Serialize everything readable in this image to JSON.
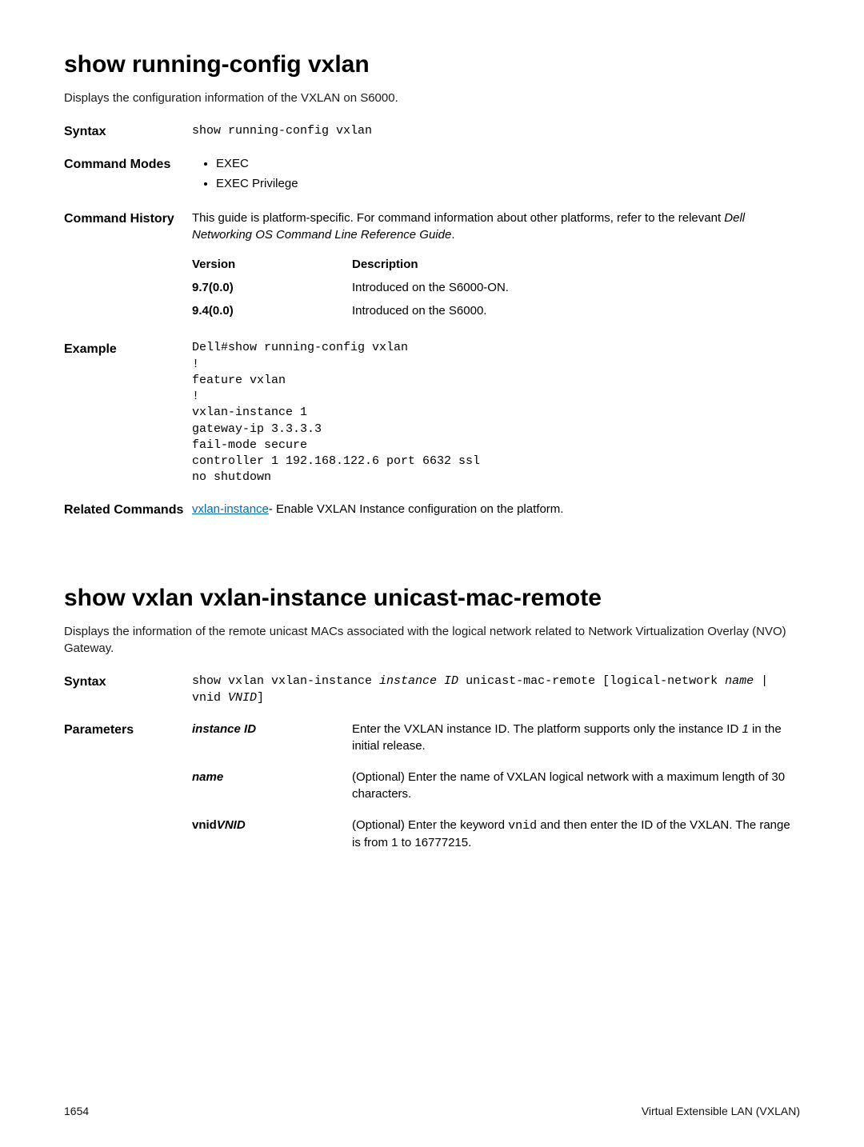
{
  "sections": [
    {
      "title": "show running-config vxlan",
      "desc": "Displays the configuration information of the VXLAN on S6000.",
      "syntax": "show running-config vxlan",
      "modes": [
        "EXEC",
        "EXEC Privilege"
      ],
      "history_intro_parts": {
        "p1": "This guide is platform-specific. For command information about other platforms, refer to the relevant ",
        "italic": "Dell Networking OS Command Line Reference Guide",
        "p2": "."
      },
      "history_header": {
        "v": "Version",
        "d": "Description"
      },
      "history": [
        {
          "v": "9.7(0.0)",
          "d": "Introduced on the S6000-ON."
        },
        {
          "v": "9.4(0.0)",
          "d": "Introduced on the S6000."
        }
      ],
      "example": "Dell#show running-config vxlan\n!\nfeature vxlan\n!\nvxlan-instance 1\ngateway-ip 3.3.3.3\nfail-mode secure\ncontroller 1 192.168.122.6 port 6632 ssl\nno shutdown",
      "related": {
        "link": "vxlan-instance",
        "rest": "- Enable VXLAN Instance configuration on the platform."
      }
    },
    {
      "title": "show vxlan vxlan-instance unicast-mac-remote",
      "desc": "Displays the information of the remote unicast MACs associated with the logical network related to Network Virtualization Overlay (NVO) Gateway.",
      "syntax_parts": {
        "p1": "show vxlan vxlan-instance ",
        "i1": "instance ID",
        "p2": " unicast-mac-remote [logical-network ",
        "i2": "name",
        "p3": " | vnid ",
        "i3": "VNID",
        "p4": "]"
      },
      "params": [
        {
          "name": "instance ID",
          "name_style": "italic",
          "desc_parts": {
            "p1": "Enter the VXLAN instance ID. The platform supports only the instance ID ",
            "i": "1",
            "p2": " in the initial release."
          }
        },
        {
          "name": "name",
          "name_style": "italic",
          "desc": "(Optional) Enter the name of VXLAN logical network with a maximum length of 30 characters."
        },
        {
          "name_pre": "vnid",
          "name_italic": "VNID",
          "desc_parts": {
            "p1": "(Optional) Enter the keyword ",
            "mono": "vnid",
            "p2": " and then enter the ID of the VXLAN. The range is from 1 to 16777215."
          }
        }
      ]
    }
  ],
  "labels": {
    "syntax": "Syntax",
    "modes": "Command Modes",
    "history": "Command History",
    "example": "Example",
    "related": "Related Commands",
    "parameters": "Parameters"
  },
  "footer": {
    "page": "1654",
    "chapter": "Virtual Extensible LAN (VXLAN)"
  }
}
